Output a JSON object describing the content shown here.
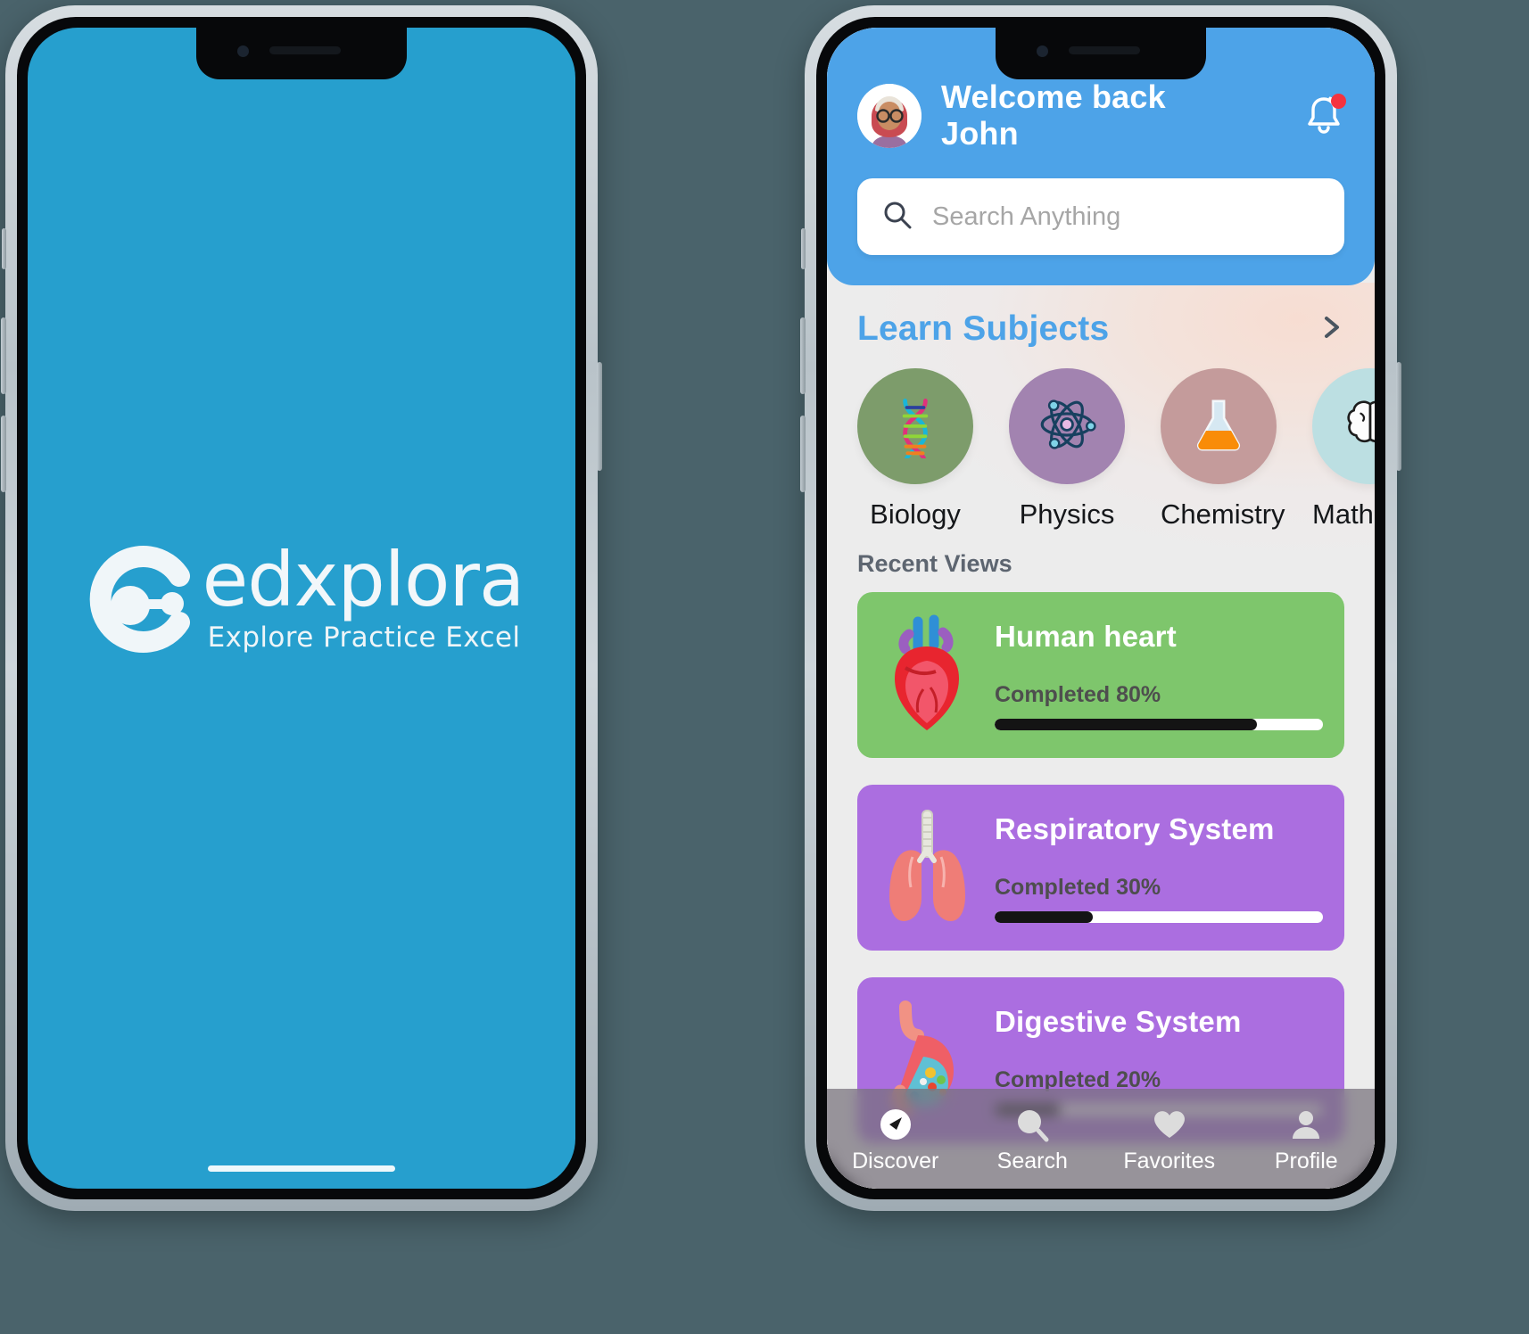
{
  "splash": {
    "background_color": "#269fce",
    "logo_icon": "edxplora-c-node-logo",
    "brand": "edxplora",
    "tagline": "Explore Practice Excel"
  },
  "app": {
    "header": {
      "background_color": "#4da3e8",
      "avatar_icon": "woman-with-headscarf-avatar",
      "welcome_line1": "Welcome back",
      "welcome_line2": "John",
      "bell_icon": "bell-icon",
      "bell_badge": true,
      "search": {
        "icon": "search-icon",
        "placeholder": "Search Anything",
        "value": ""
      }
    },
    "learn_subjects": {
      "title": "Learn Subjects",
      "more_icon": "chevron-right-icon",
      "items": [
        {
          "label": "Biology",
          "icon": "dna-icon",
          "circle_color": "#7d9c6b"
        },
        {
          "label": "Physics",
          "icon": "atom-icon",
          "circle_color": "#a283b0"
        },
        {
          "label": "Chemistry",
          "icon": "flask-icon",
          "circle_color": "#c49b9b"
        },
        {
          "label": "Mathematics",
          "icon": "brain-icon",
          "circle_color": "#bcdfe2"
        }
      ]
    },
    "recent_views": {
      "title": "Recent Views",
      "cards": [
        {
          "title": "Human heart",
          "icon": "heart-organ-icon",
          "progress_label": "Completed 80%",
          "progress": 80,
          "color": "#7ec66c"
        },
        {
          "title": "Respiratory System",
          "icon": "lungs-icon",
          "progress_label": "Completed 30%",
          "progress": 30,
          "color": "#ab6ee0"
        },
        {
          "title": "Digestive System",
          "icon": "stomach-icon",
          "progress_label": "Completed 20%",
          "progress": 20,
          "color": "#ab6ee0"
        }
      ]
    },
    "tabbar": {
      "items": [
        {
          "label": "Discover",
          "icon": "compass-icon",
          "active": true
        },
        {
          "label": "Search",
          "icon": "magnifier-icon",
          "active": false
        },
        {
          "label": "Favorites",
          "icon": "heart-icon",
          "active": false
        },
        {
          "label": "Profile",
          "icon": "person-icon",
          "active": false
        }
      ]
    }
  }
}
